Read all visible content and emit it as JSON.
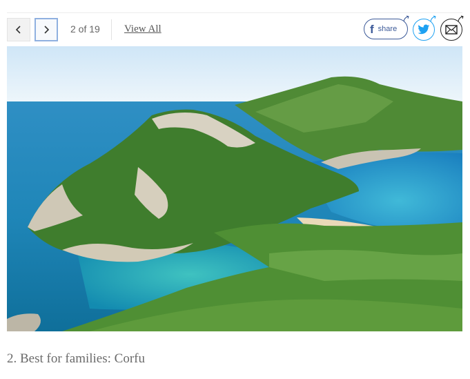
{
  "gallery": {
    "counter": "2 of 19",
    "view_all_label": "View All",
    "prev_icon": "chevron-left-icon",
    "next_icon": "chevron-right-icon"
  },
  "share": {
    "facebook_label": "share",
    "facebook_glyph": "f",
    "facebook_color": "#3b5998",
    "twitter_color": "#1da1f2",
    "email_color": "#222222"
  },
  "slide": {
    "caption": "2. Best for families: Corfu"
  }
}
